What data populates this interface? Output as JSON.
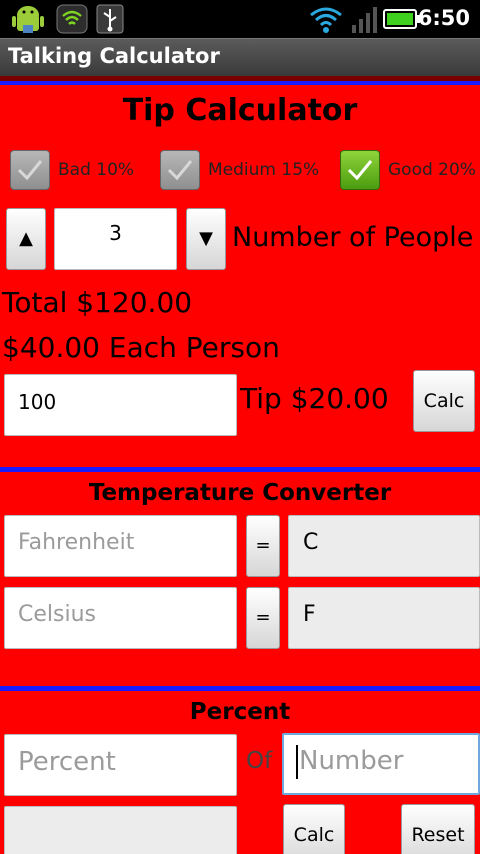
{
  "status_bar": {
    "time": "6:50",
    "icons": [
      "android-icon",
      "shield-icon",
      "usb-icon",
      "wifi-icon",
      "signal-icon",
      "battery-icon"
    ]
  },
  "app": {
    "title": "Talking Calculator"
  },
  "tip_calculator": {
    "heading": "Tip Calculator",
    "options": [
      {
        "label": "Bad 10%",
        "checked": false
      },
      {
        "label": "Medium 15%",
        "checked": false
      },
      {
        "label": "Good 20%",
        "checked": true
      }
    ],
    "stepper": {
      "up": "▲",
      "value": "3",
      "down": "▼",
      "label": "Number of People"
    },
    "total": "Total $120.00",
    "each_person": "$40.00 Each Person",
    "amount_value": "100",
    "tip": "Tip $20.00",
    "calc_label": "Calc"
  },
  "temperature_converter": {
    "heading": "Temperature Converter",
    "rows": [
      {
        "placeholder": "Fahrenheit",
        "equals": "=",
        "result": "C"
      },
      {
        "placeholder": "Celsius",
        "equals": "=",
        "result": "F"
      }
    ]
  },
  "percent": {
    "heading": "Percent",
    "percent_placeholder": "Percent",
    "of_label": "Of",
    "number_placeholder": "Number",
    "result_value": "",
    "calc_label": "Calc",
    "reset_label": "Reset"
  },
  "colors": {
    "background": "#ff0000",
    "divider": "#1a1aff",
    "checkbox_on": "#4c9c10"
  }
}
